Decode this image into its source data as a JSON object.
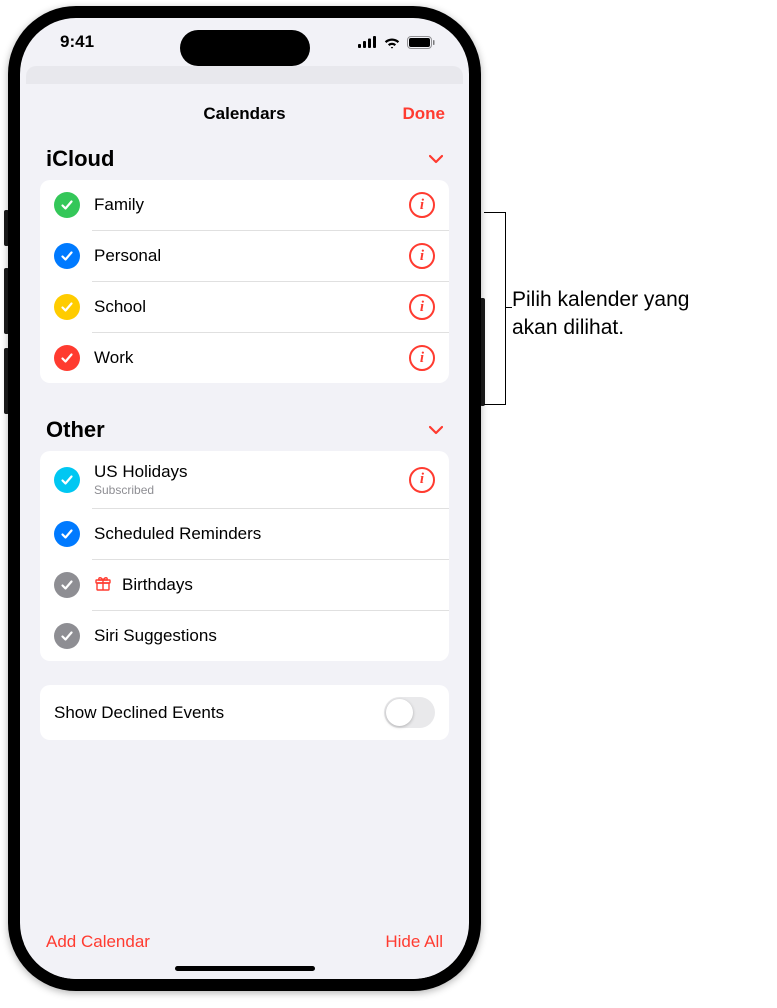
{
  "status": {
    "time": "9:41"
  },
  "sheet": {
    "title": "Calendars",
    "done": "Done"
  },
  "sections": [
    {
      "title": "iCloud",
      "rows": [
        {
          "label": "Family",
          "color": "#34c759",
          "checked": true,
          "info": true
        },
        {
          "label": "Personal",
          "color": "#007aff",
          "checked": true,
          "info": true
        },
        {
          "label": "School",
          "color": "#ffcc00",
          "checked": true,
          "info": true
        },
        {
          "label": "Work",
          "color": "#ff3b30",
          "checked": true,
          "info": true
        }
      ]
    },
    {
      "title": "Other",
      "rows": [
        {
          "label": "US Holidays",
          "sub": "Subscribed",
          "color": "#00c7f2",
          "checked": true,
          "info": true
        },
        {
          "label": "Scheduled Reminders",
          "color": "#007aff",
          "checked": true,
          "info": false
        },
        {
          "label": "Birthdays",
          "icon": "gift",
          "color": "#8e8e93",
          "checked": true,
          "info": false
        },
        {
          "label": "Siri Suggestions",
          "color": "#8e8e93",
          "checked": true,
          "info": false
        }
      ]
    }
  ],
  "options": {
    "declined_label": "Show Declined Events",
    "declined_on": false
  },
  "footer": {
    "add": "Add Calendar",
    "hide": "Hide All"
  },
  "callout": {
    "line1": "Pilih kalender yang",
    "line2": "akan dilihat."
  }
}
